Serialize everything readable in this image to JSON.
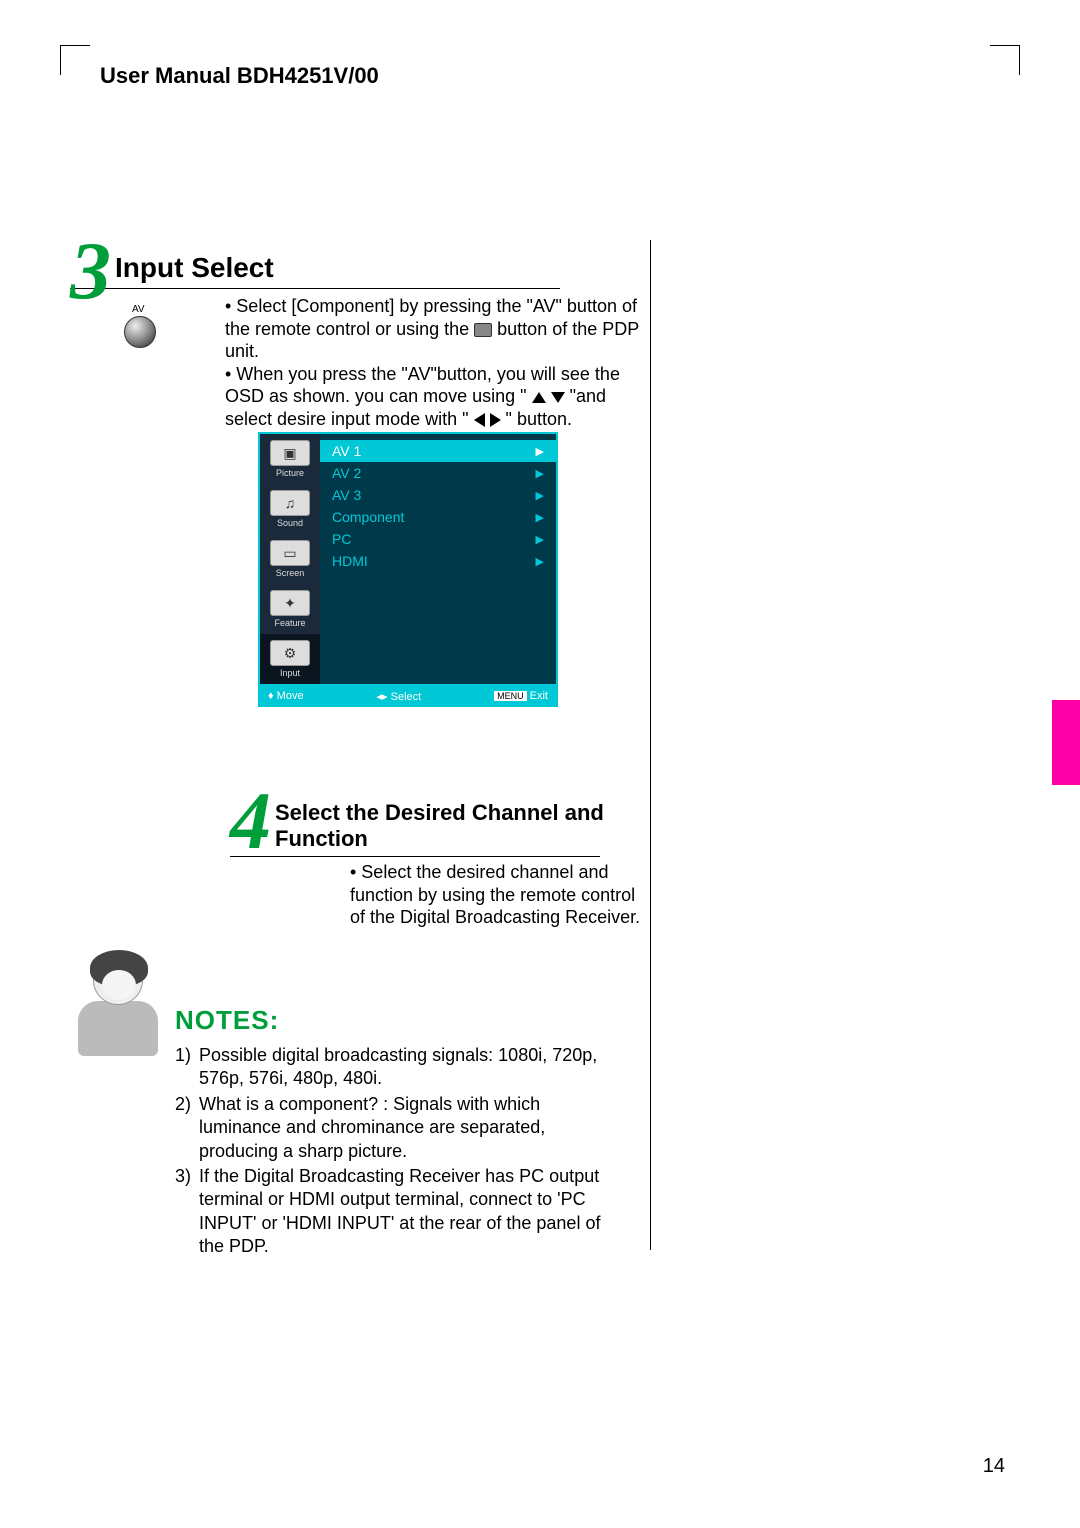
{
  "header": {
    "title": "User Manual BDH4251V/00"
  },
  "page_number": "14",
  "section3": {
    "number": "3",
    "title": "Input Select",
    "av_label": "AV",
    "bullet1_a": "• Select [Component] by pressing the \"AV\" button of the remote control or using the ",
    "bullet1_b": " button of the PDP unit.",
    "bullet2_a": "• When you press the \"AV\"button, you will see the OSD as shown. you can move using \" ",
    "bullet2_b": " \"and select desire input mode with \" ",
    "bullet2_c": " \" button."
  },
  "osd": {
    "side": [
      {
        "label": "Picture"
      },
      {
        "label": "Sound"
      },
      {
        "label": "Screen"
      },
      {
        "label": "Feature"
      },
      {
        "label": "Input"
      }
    ],
    "items": [
      {
        "label": "AV 1",
        "selected": true
      },
      {
        "label": "AV 2",
        "selected": false
      },
      {
        "label": "AV 3",
        "selected": false
      },
      {
        "label": "Component",
        "selected": false
      },
      {
        "label": "PC",
        "selected": false
      },
      {
        "label": "HDMI",
        "selected": false
      }
    ],
    "footer": {
      "move": "Move",
      "select": "Select",
      "menu_badge": "MENU",
      "exit": "Exit"
    }
  },
  "section4": {
    "number": "4",
    "title": "Select the Desired Channel and Function",
    "body": "• Select the desired channel and function by using the remote control of the Digital Broadcasting Receiver."
  },
  "notes": {
    "title": "NOTES:",
    "items": [
      {
        "n": "1)",
        "t": "Possible digital broadcasting signals: 1080i, 720p, 576p, 576i, 480p, 480i."
      },
      {
        "n": "2)",
        "t": "What is a component? : Signals with which luminance and chrominance are separated, producing a sharp picture."
      },
      {
        "n": "3)",
        "t": "If the Digital Broadcasting Receiver has PC output terminal or HDMI output terminal, connect to 'PC INPUT' or 'HDMI INPUT' at the rear of the panel of the PDP."
      }
    ]
  }
}
